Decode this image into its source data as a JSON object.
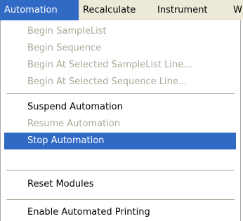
{
  "colors": {
    "menubar_bg": "#ece9d8",
    "highlight": "#316ac5",
    "disabled_text": "#aca899",
    "menu_bg": "#ffffff"
  },
  "menubar": {
    "items": [
      {
        "label": "Automation",
        "state": "open"
      },
      {
        "label": "Recalculate"
      },
      {
        "label": "Instrument"
      },
      {
        "label": "W"
      }
    ]
  },
  "menu": {
    "items": [
      {
        "label": "Begin SampleList",
        "enabled": false
      },
      {
        "label": "Begin Sequence",
        "enabled": false
      },
      {
        "label": "Begin At Selected SampleList Line...",
        "enabled": false
      },
      {
        "label": "Begin At Selected Sequence Line...",
        "enabled": false
      },
      {
        "label": "Suspend Automation",
        "enabled": true
      },
      {
        "label": "Resume Automation",
        "enabled": false
      },
      {
        "label": "Stop Automation",
        "enabled": true,
        "highlighted": true
      },
      {
        "label": "Reset Modules",
        "enabled": true
      },
      {
        "label": "Enable Automated Printing",
        "enabled": true
      }
    ]
  }
}
